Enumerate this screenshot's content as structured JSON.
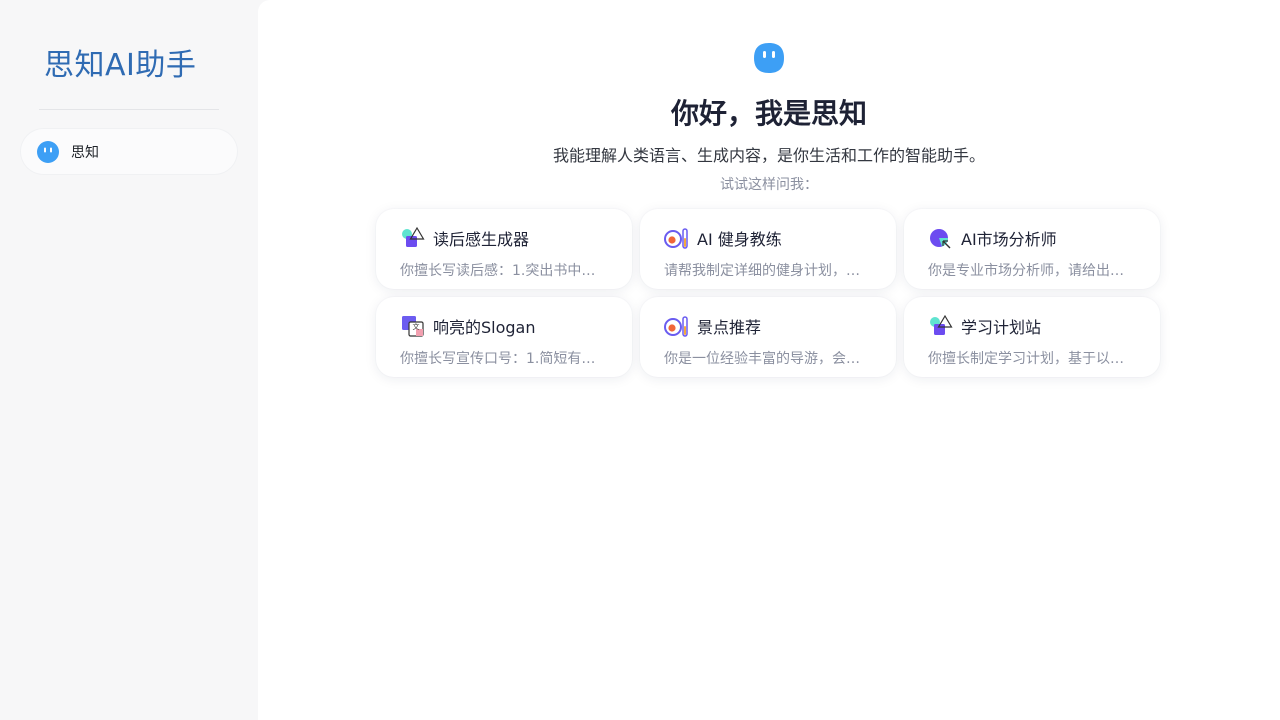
{
  "sidebar": {
    "brand": "思知AI助手",
    "assistant": {
      "label": "思知"
    }
  },
  "main": {
    "greeting": "你好，我是思知",
    "subtitle": "我能理解人类语言、生成内容，是你生活和工作的智能助手。",
    "hint": "试试这样问我：",
    "cards": [
      {
        "title": "读后感生成器",
        "desc": "你擅长写读后感：1.突出书中…",
        "icon": "shapes-icon"
      },
      {
        "title": "AI 健身教练",
        "desc": "请帮我制定详细的健身计划，…",
        "icon": "plate-icon"
      },
      {
        "title": "AI市场分析师",
        "desc": "你是专业市场分析师，请给出…",
        "icon": "pie-chart-icon"
      },
      {
        "title": "响亮的Slogan",
        "desc": "你擅长写宣传口号：1.简短有…",
        "icon": "translate-icon"
      },
      {
        "title": "景点推荐",
        "desc": "你是一位经验丰富的导游，会…",
        "icon": "plate-icon"
      },
      {
        "title": "学习计划站",
        "desc": "你擅长制定学习计划，基于以…",
        "icon": "shapes-icon"
      }
    ]
  },
  "colors": {
    "brand": "#2f6bb3",
    "avatar": "#3d9ff5",
    "sidebar_bg": "#f7f7f8",
    "title": "#1e2235",
    "muted": "#8b90a0"
  }
}
